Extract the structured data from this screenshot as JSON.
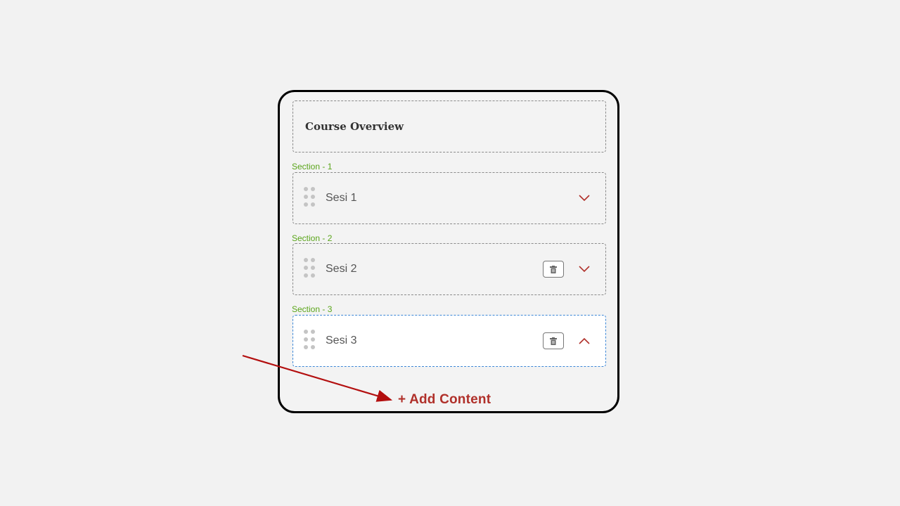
{
  "overview": {
    "title": "Course Overview"
  },
  "sections": [
    {
      "label": "Section - 1",
      "session": "Sesi 1",
      "deletable": false,
      "expanded": false,
      "active": false
    },
    {
      "label": "Section - 2",
      "session": "Sesi 2",
      "deletable": true,
      "expanded": false,
      "active": false
    },
    {
      "label": "Section - 3",
      "session": "Sesi 3",
      "deletable": true,
      "expanded": true,
      "active": true
    }
  ],
  "add_content": {
    "label": "+ Add Content"
  },
  "colors": {
    "accent_red": "#b0302a",
    "section_label_green": "#5aa51a",
    "active_border_blue": "#3b86d6",
    "arrow_red": "#b30f0f"
  },
  "icons": {
    "drag": "drag-handle-icon",
    "delete": "trash-icon",
    "collapsed": "chevron-down-icon",
    "expanded": "chevron-up-icon"
  }
}
